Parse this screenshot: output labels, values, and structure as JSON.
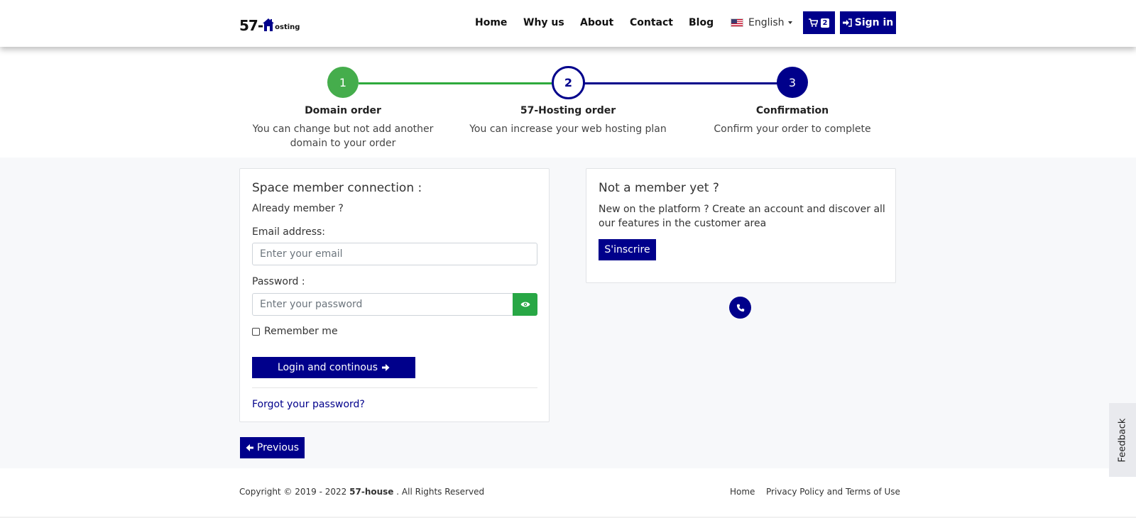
{
  "header": {
    "logo": {
      "number": "57-",
      "word": "osting"
    },
    "nav": [
      {
        "label": "Home"
      },
      {
        "label": "Why us"
      },
      {
        "label": "About"
      },
      {
        "label": "Contact"
      },
      {
        "label": "Blog"
      }
    ],
    "language": "English",
    "cart_count": "2",
    "signin_label": "Sign in"
  },
  "stepper": {
    "steps": [
      {
        "number": "1",
        "title": "Domain order",
        "description": "You can change but not add another domain to your order",
        "state": "completed"
      },
      {
        "number": "2",
        "title": "57-Hosting order",
        "description": "You can increase your web hosting plan",
        "state": "current"
      },
      {
        "number": "3",
        "title": "Confirmation",
        "description": "Confirm your order to complete",
        "state": "upcoming"
      }
    ]
  },
  "login": {
    "title": "Space member connection :",
    "subtitle": "Already member ?",
    "email_label": "Email address:",
    "email_placeholder": "Enter your email",
    "password_label": "Password :",
    "password_placeholder": "Enter your password",
    "remember_label": "Remember me",
    "submit_label": "Login and continous",
    "forgot_label": "Forgot your password?"
  },
  "register": {
    "title": "Not a member yet ?",
    "text": "New on the platform ? Create an account and discover all our features in the customer area",
    "button_label": "S'inscrire"
  },
  "previous_label": "Previous",
  "footer": {
    "copyright_prefix": "Copyright © 2019 - 2022",
    "brand": "57-house",
    "copyright_suffix": ". All Rights Reserved",
    "links": [
      {
        "label": "Home"
      },
      {
        "label": "Privacy Policy and Terms of Use"
      }
    ]
  },
  "feedback_label": "Feedback",
  "colors": {
    "primary": "#00008b",
    "success": "#28a745",
    "completed_step": "#45ad4c"
  }
}
